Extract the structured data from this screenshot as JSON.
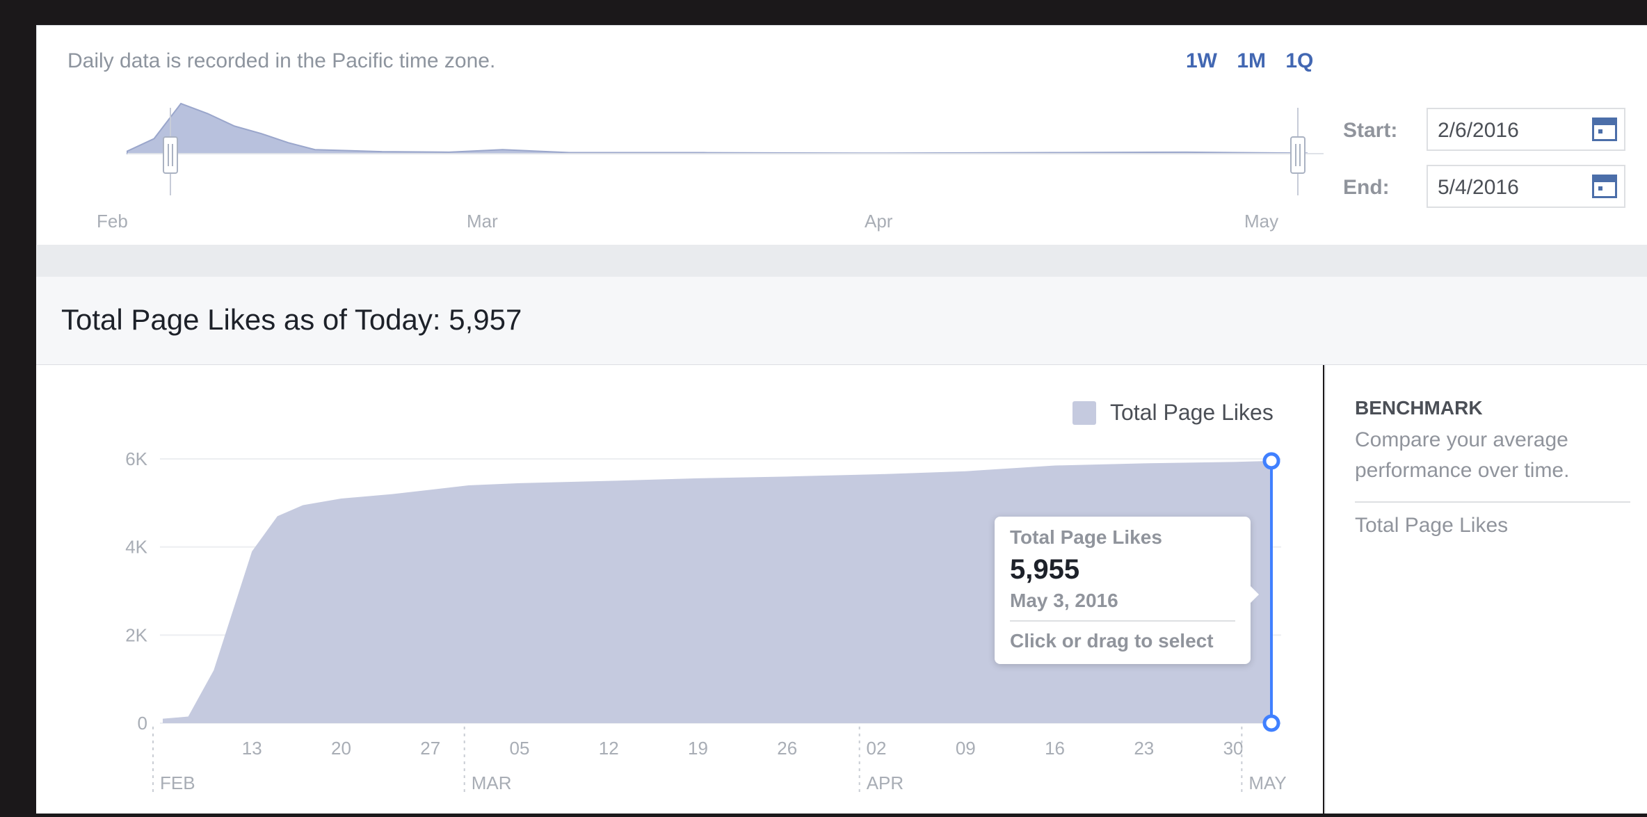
{
  "range_panel": {
    "note": "Daily data is recorded in the Pacific time zone.",
    "range_buttons": [
      "1W",
      "1M",
      "1Q"
    ],
    "start_label": "Start:",
    "start_value": "2/6/2016",
    "end_label": "End:",
    "end_value": "5/4/2016",
    "month_labels": [
      "Feb",
      "Mar",
      "Apr",
      "May"
    ]
  },
  "summary": {
    "title": "Total Page Likes as of Today: 5,957"
  },
  "legend": {
    "label": "Total Page Likes",
    "color": "#c5cadf"
  },
  "tooltip": {
    "title": "Total Page Likes",
    "value": "5,955",
    "date": "May 3, 2016",
    "hint": "Click or drag to select"
  },
  "benchmark": {
    "title": "BENCHMARK",
    "description": "Compare your average performance over time.",
    "metric": "Total Page Likes"
  },
  "colors": {
    "accent": "#4267b2",
    "area_fill": "#c5cadf",
    "selection_line": "#4080ff"
  },
  "chart_data": {
    "type": "area",
    "y_ticks": [
      "6K",
      "4K",
      "2K",
      "0"
    ],
    "ylim": [
      0,
      6000
    ],
    "x_tick_labels": [
      "13",
      "20",
      "27",
      "05",
      "12",
      "19",
      "26",
      "02",
      "09",
      "16",
      "23",
      "30"
    ],
    "month_labels": [
      "FEB",
      "MAR",
      "APR",
      "MAY"
    ],
    "legend": "Total Page Likes",
    "series": [
      {
        "name": "Total Page Likes",
        "x": [
          "2016-02-06",
          "2016-02-08",
          "2016-02-10",
          "2016-02-12",
          "2016-02-13",
          "2016-02-15",
          "2016-02-17",
          "2016-02-20",
          "2016-02-24",
          "2016-02-27",
          "2016-03-01",
          "2016-03-05",
          "2016-03-12",
          "2016-03-19",
          "2016-03-26",
          "2016-04-02",
          "2016-04-09",
          "2016-04-16",
          "2016-04-23",
          "2016-04-30",
          "2016-05-03"
        ],
        "values": [
          100,
          150,
          1200,
          3000,
          3900,
          4700,
          4950,
          5100,
          5200,
          5300,
          5400,
          5450,
          5500,
          5560,
          5600,
          5650,
          5720,
          5850,
          5900,
          5930,
          5955
        ]
      }
    ],
    "selected_point": {
      "x": "2016-05-03",
      "value": 5955
    }
  },
  "overview_data": {
    "type": "area",
    "x": [
      "2016-02-06",
      "2016-02-08",
      "2016-02-10",
      "2016-02-12",
      "2016-02-14",
      "2016-02-16",
      "2016-02-18",
      "2016-02-20",
      "2016-02-25",
      "2016-03-01",
      "2016-03-05",
      "2016-03-10",
      "2016-03-20",
      "2016-04-01",
      "2016-04-15",
      "2016-04-25",
      "2016-05-04"
    ],
    "values": [
      5,
      30,
      100,
      80,
      55,
      40,
      22,
      8,
      4,
      3,
      8,
      2,
      2,
      1,
      2,
      3,
      1
    ]
  }
}
